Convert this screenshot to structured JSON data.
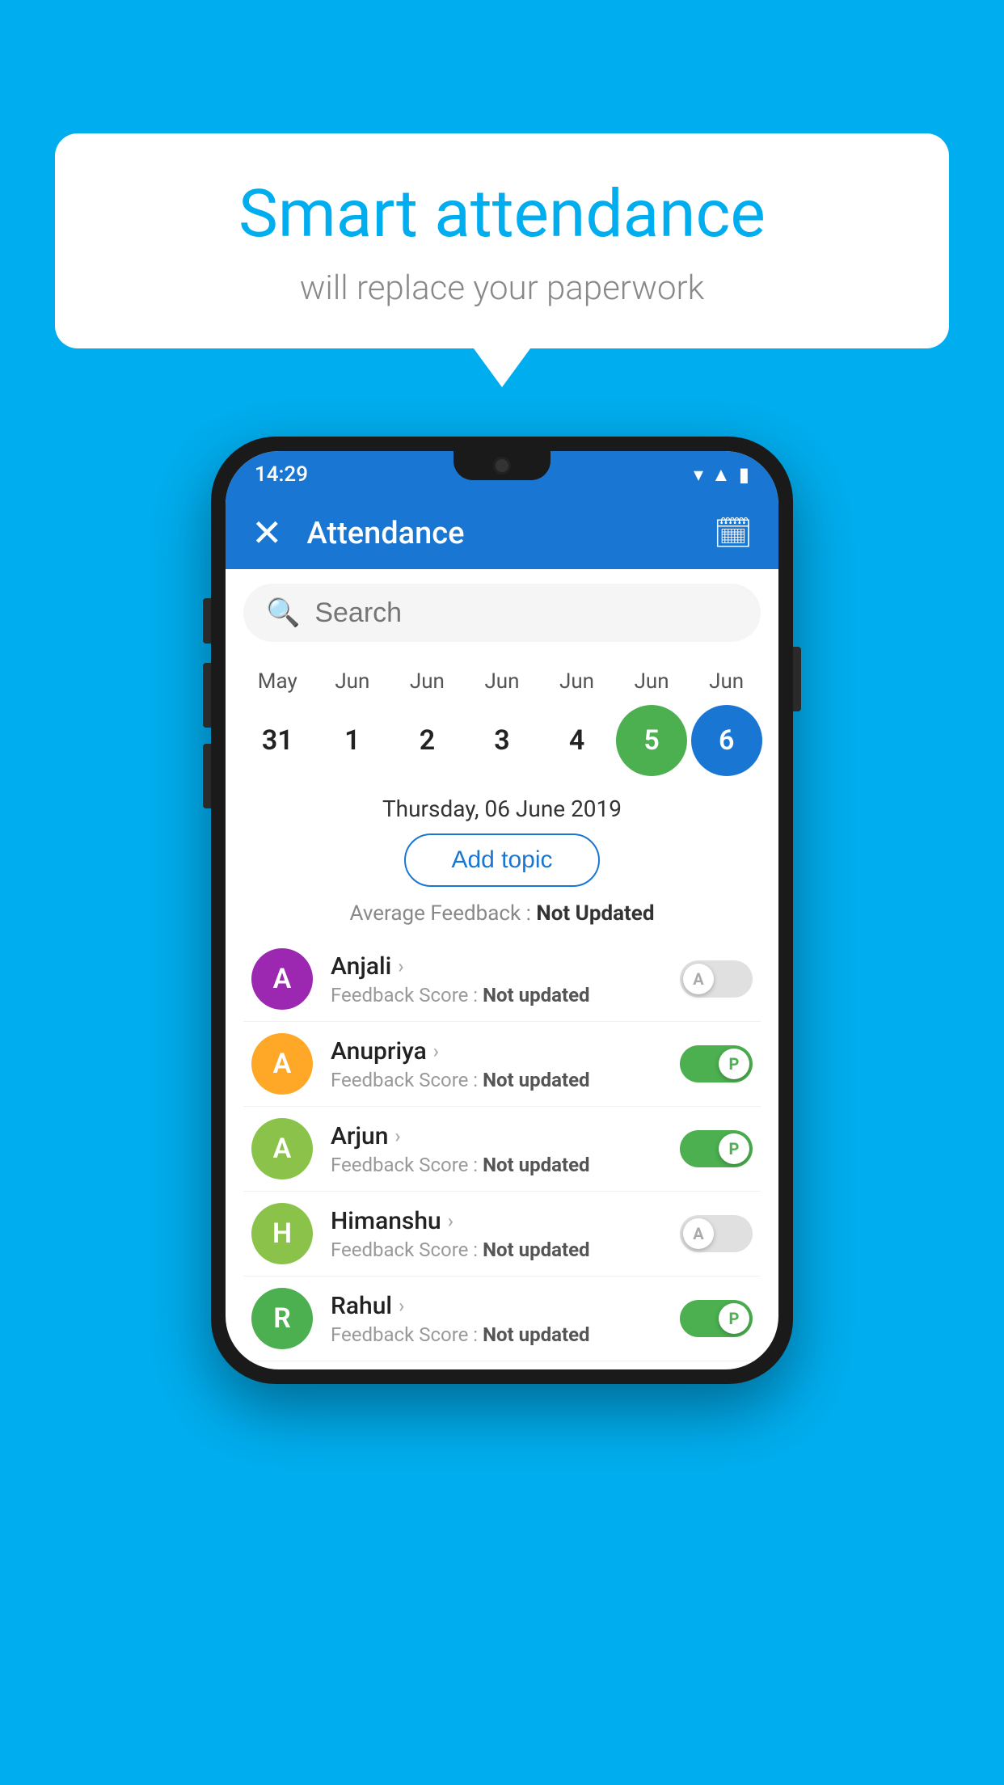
{
  "background_color": "#00AEEF",
  "speech_bubble": {
    "title": "Smart attendance",
    "subtitle": "will replace your paperwork"
  },
  "status_bar": {
    "time": "14:29",
    "icons": [
      "wifi",
      "signal",
      "battery"
    ]
  },
  "app_bar": {
    "title": "Attendance",
    "close_label": "✕",
    "calendar_label": "📅"
  },
  "search": {
    "placeholder": "Search"
  },
  "calendar": {
    "months": [
      "May",
      "Jun",
      "Jun",
      "Jun",
      "Jun",
      "Jun",
      "Jun"
    ],
    "days": [
      "31",
      "1",
      "2",
      "3",
      "4",
      "5",
      "6"
    ],
    "today_index": 5,
    "selected_index": 6
  },
  "selected_date_label": "Thursday, 06 June 2019",
  "add_topic_label": "Add topic",
  "avg_feedback_label": "Average Feedback :",
  "avg_feedback_value": "Not Updated",
  "students": [
    {
      "name": "Anjali",
      "feedback_label": "Feedback Score :",
      "feedback_value": "Not updated",
      "avatar_letter": "A",
      "avatar_color": "#9C27B0",
      "toggle": "off",
      "toggle_label": "A"
    },
    {
      "name": "Anupriya",
      "feedback_label": "Feedback Score :",
      "feedback_value": "Not updated",
      "avatar_letter": "A",
      "avatar_color": "#FFA726",
      "toggle": "on",
      "toggle_label": "P"
    },
    {
      "name": "Arjun",
      "feedback_label": "Feedback Score :",
      "feedback_value": "Not updated",
      "avatar_letter": "A",
      "avatar_color": "#8BC34A",
      "toggle": "on",
      "toggle_label": "P"
    },
    {
      "name": "Himanshu",
      "feedback_label": "Feedback Score :",
      "feedback_value": "Not updated",
      "avatar_letter": "H",
      "avatar_color": "#8BC34A",
      "toggle": "off",
      "toggle_label": "A"
    },
    {
      "name": "Rahul",
      "feedback_label": "Feedback Score :",
      "feedback_value": "Not updated",
      "avatar_letter": "R",
      "avatar_color": "#4CAF50",
      "toggle": "on",
      "toggle_label": "P"
    }
  ]
}
